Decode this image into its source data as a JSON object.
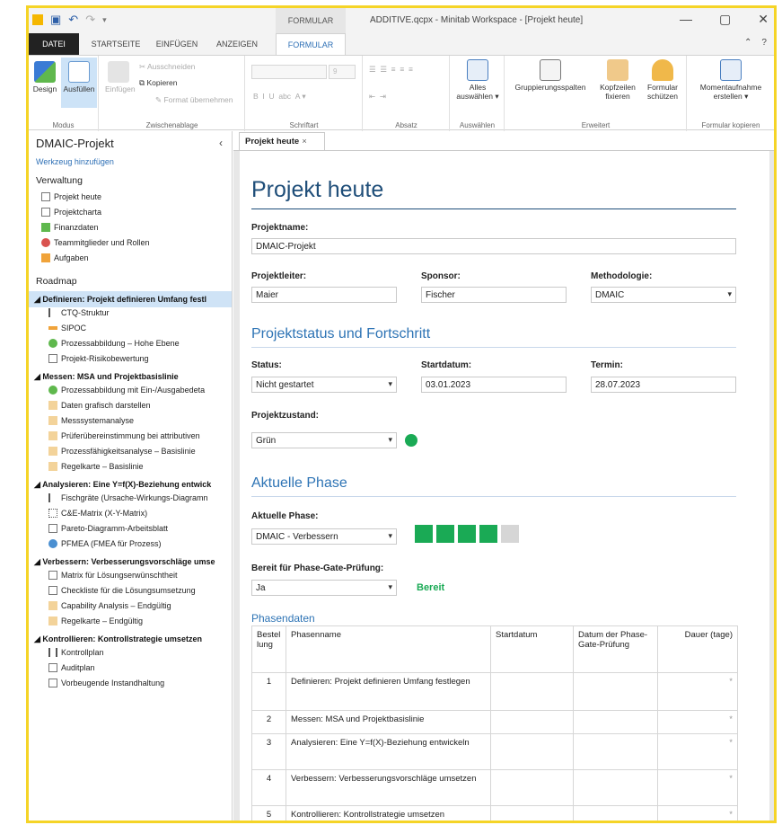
{
  "window": {
    "title": "ADDITIVE.qcpx - Minitab Workspace - [Projekt heute]",
    "context_tab_header": "FORMULAR",
    "controls": [
      "—",
      "▢",
      "✕"
    ]
  },
  "ribbon_tabs": [
    "DATEI",
    "STARTSEITE",
    "EINFÜGEN",
    "ANZEIGEN",
    "FORMULAR"
  ],
  "ribbon": {
    "modus": {
      "label": "Modus",
      "design": "Design",
      "ausfuellen": "Ausfüllen"
    },
    "zwischenablage": {
      "label": "Zwischenablage",
      "einfuegen": "Einfügen",
      "ausschneiden": "Ausschneiden",
      "kopieren": "Kopieren",
      "format": "Format übernehmen"
    },
    "schriftart": {
      "label": "Schriftart",
      "size": "9"
    },
    "absatz": {
      "label": "Absatz"
    },
    "auswaehlen": {
      "label": "Auswählen",
      "alles": "Alles auswählen ▾"
    },
    "erweitert": {
      "label": "Erweitert",
      "gruppierung": "Gruppierungsspalten",
      "kopfzeilen": "Kopfzeilen fixieren",
      "formular": "Formular schützen"
    },
    "kopieren_grp": {
      "label": "Formular kopieren",
      "moment": "Momentaufnahme erstellen ▾"
    }
  },
  "left_pane": {
    "title": "DMAIC-Projekt",
    "add_tool": "Werkzeug hinzufügen",
    "verwaltung_label": "Verwaltung",
    "verwaltung": [
      "Projekt heute",
      "Projektcharta",
      "Finanzdaten",
      "Teammitglieder und Rollen",
      "Aufgaben"
    ],
    "roadmap_label": "Roadmap",
    "phases": [
      {
        "name": "Definieren: Projekt definieren Umfang festl",
        "items": [
          "CTQ-Struktur",
          "SIPOC",
          "Prozessabbildung – Hohe Ebene",
          "Projekt-Risikobewertung"
        ]
      },
      {
        "name": "Messen: MSA und Projektbasislinie",
        "items": [
          "Prozessabbildung mit Ein-/Ausgabedeta",
          "Daten grafisch darstellen",
          "Messsystemanalyse",
          "Prüferübereinstimmung bei attributiven",
          "Prozessfähigkeitsanalyse – Basislinie",
          "Regelkarte – Basislinie"
        ]
      },
      {
        "name": "Analysieren: Eine Y=f(X)-Beziehung entwick",
        "items": [
          "Fischgräte (Ursache-Wirkungs-Diagramn",
          "C&E-Matrix (X-Y-Matrix)",
          "Pareto-Diagramm-Arbeitsblatt",
          "PFMEA (FMEA für Prozess)"
        ]
      },
      {
        "name": "Verbessern: Verbesserungsvorschläge umse",
        "items": [
          "Matrix für Lösungserwünschtheit",
          "Checkliste für die Lösungsumsetzung",
          "Capability Analysis – Endgültig",
          "Regelkarte – Endgültig"
        ]
      },
      {
        "name": "Kontrollieren: Kontrollstrategie umsetzen",
        "items": [
          "Kontrollplan",
          "Auditplan",
          "Vorbeugende Instandhaltung"
        ]
      }
    ]
  },
  "doc_tab": "Projekt heute",
  "form": {
    "title": "Projekt heute",
    "projektname_label": "Projektname:",
    "projektname": "DMAIC-Projekt",
    "projektleiter_label": "Projektleiter:",
    "projektleiter": "Maier",
    "sponsor_label": "Sponsor:",
    "sponsor": "Fischer",
    "methodologie_label": "Methodologie:",
    "methodologie": "DMAIC",
    "status_heading": "Projektstatus und Fortschritt",
    "status_label": "Status:",
    "status": "Nicht gestartet",
    "startdatum_label": "Startdatum:",
    "startdatum": "03.01.2023",
    "termin_label": "Termin:",
    "termin": "28.07.2023",
    "zustand_label": "Projektzustand:",
    "zustand": "Grün",
    "phase_heading": "Aktuelle Phase",
    "phase_label": "Aktuelle Phase:",
    "phase": "DMAIC - Verbessern",
    "phase_progress_completed": 4,
    "phase_progress_total": 5,
    "gate_label": "Bereit für Phase-Gate-Prüfung:",
    "gate": "Ja",
    "gate_status": "Bereit",
    "phasendaten_heading": "Phasendaten",
    "table_headers": [
      "Bestel lung",
      "Phasenname",
      "Startdatum",
      "Datum der Phase-Gate-Prüfung",
      "Dauer (tage)"
    ],
    "rows": [
      {
        "num": "1",
        "name": "Definieren: Projekt definieren Umfang festlegen",
        "dur": "*"
      },
      {
        "num": "2",
        "name": "Messen: MSA und Projektbasislinie",
        "dur": "*"
      },
      {
        "num": "3",
        "name": "Analysieren: Eine Y=f(X)-Beziehung entwickeln",
        "dur": "*"
      },
      {
        "num": "4",
        "name": "Verbessern: Verbesserungsvorschläge umsetzen",
        "dur": "*"
      },
      {
        "num": "5",
        "name": "Kontrollieren: Kontrollstrategie umsetzen",
        "dur": "*"
      }
    ]
  },
  "colors": {
    "accent": "#2d6fb5",
    "title": "#1f4e79",
    "green": "#1aaa55",
    "frame": "#f5d427"
  }
}
